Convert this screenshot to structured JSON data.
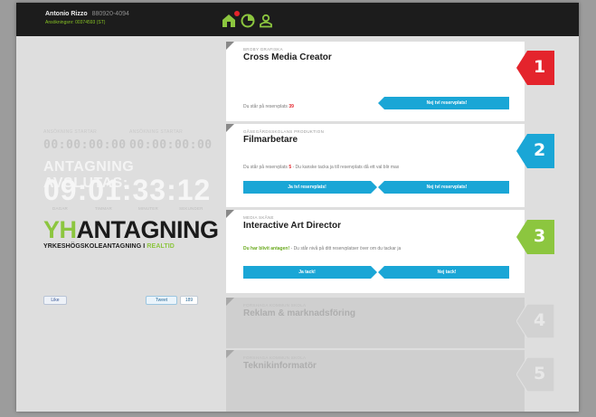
{
  "user": {
    "name": "Antonio Rizzo",
    "id": "880920-4094",
    "subline": "Ansökningsnr: 00374593 (ST)"
  },
  "nav": {
    "icons": [
      "home-icon",
      "pie-chart-icon",
      "user-icon"
    ],
    "active": "home-icon",
    "notification_color": "#e4242c"
  },
  "countdown": {
    "small_labels": [
      "ANSÖKNING STARTAR",
      "ANSÖKNING STARTAR"
    ],
    "small_values": [
      "00:00:00:00",
      "00:00:00:00"
    ],
    "title": "ANTAGNING AVSLUTAS:",
    "time": "09:01:33:12",
    "units": [
      "DAGAR",
      "TIMMAR",
      "MINUTER",
      "SEKUNDER"
    ]
  },
  "logo": {
    "yh": "YH",
    "antagning": "ANTAGNING",
    "sub": "YRKESHÖGSKOLEANTAGNING I",
    "sub_highlight": "REALTID"
  },
  "social": {
    "like": "Like",
    "tweet": "Tweet",
    "count": "189"
  },
  "programs": [
    {
      "rank": "1",
      "rank_color": "#e4242c",
      "kicker": "BROBY GRAFISKA",
      "title": "Cross Media Creator",
      "line_prefix": "Du står på reservplats",
      "line_highlight": "39",
      "line_suffix": "",
      "buttons": [
        "Nej tvl reservplats!"
      ]
    },
    {
      "rank": "2",
      "rank_color": "#1aa6d6",
      "kicker": "GÅSEGÅRDSSKOLANS PRODUKTION",
      "title": "Filmarbetare",
      "line_prefix": "Du står på reservplats",
      "line_highlight": "5",
      "line_suffix": "- Du kanske tacka ja till reservplats då ett val blir max",
      "buttons": [
        "Ja tvl reservplats!",
        "Nej tvl reservplats!"
      ]
    },
    {
      "rank": "3",
      "rank_color": "#8cc63f",
      "kicker": "MEDIA SKÅNE",
      "title": "Interactive Art Director",
      "line_prefix": "",
      "line_highlight": "Du har blivit antagen!",
      "line_suffix": "- Du står nivå på ditt reservplatser över om du tackar ja",
      "buttons": [
        "Ja tack!",
        "Nej tack!"
      ]
    },
    {
      "rank": "4",
      "rank_color": "#cfcfcf",
      "kicker": "FORSHAGA KOMMUN SKOLA",
      "title": "Reklam & marknadsföring",
      "buttons": []
    },
    {
      "rank": "5",
      "rank_color": "#cfcfcf",
      "kicker": "FORSHAGA KOMMUN SKOLA",
      "title": "Teknikinformatör",
      "buttons": []
    }
  ]
}
